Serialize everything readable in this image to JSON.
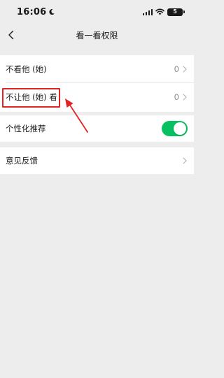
{
  "status_bar": {
    "time": "16:06",
    "battery": "5",
    "icons": [
      "moon-icon",
      "signal-icon",
      "wifi-icon",
      "battery-icon"
    ]
  },
  "nav": {
    "title": "看一看权限",
    "back_icon": "chevron-left-icon"
  },
  "settings": {
    "rows": [
      {
        "label": "不看他 (她)",
        "value": "0"
      },
      {
        "label": "不让他 (她) 看",
        "value": "0"
      }
    ],
    "personalized": {
      "label": "个性化推荐",
      "enabled": true
    },
    "feedback": {
      "label": "意见反馈"
    }
  },
  "annotation": {
    "highlight_color": "#e02424",
    "arrow_color": "#e02424"
  },
  "colors": {
    "background": "#ededed",
    "toggle_on": "#07c160",
    "secondary_text": "#8c8c8c"
  }
}
